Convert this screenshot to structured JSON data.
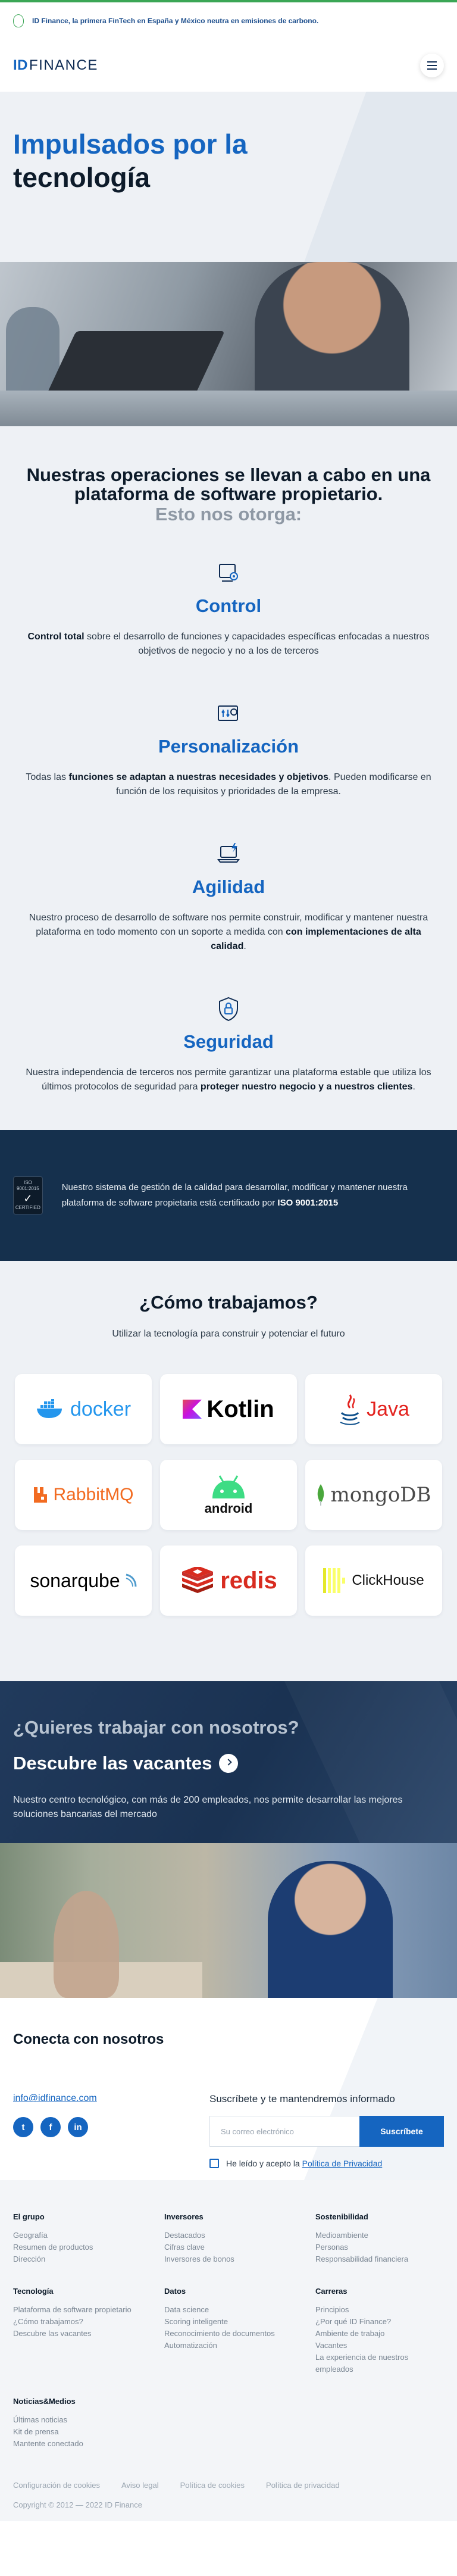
{
  "topbar": {
    "text": "ID Finance, la primera FinTech en España y México neutra en emisiones de carbono."
  },
  "header": {
    "logo_id": "ID",
    "logo_finance": "FINANCE"
  },
  "hero": {
    "title_blue": "Impulsados por la",
    "title_dark": "tecnología"
  },
  "ops": {
    "title": "Nuestras operaciones se llevan a cabo en una plataforma de software propietario.",
    "subtitle": "Esto nos otorga:",
    "features": [
      {
        "icon": "monitor-gear-icon",
        "title": "Control",
        "p1_b": "Control total",
        "p1": " sobre el desarrollo de funciones y capacidades específicas enfocadas a nuestros objetivos de negocio y no a los de terceros",
        "p2": "",
        "p2_b": "",
        "p3": ""
      },
      {
        "icon": "sliders-icon",
        "title": "Personalización",
        "p1": "Todas las ",
        "p1_b": "funciones se adaptan a nuestras necesidades y objetivos",
        "p2": ". Pueden modificarse en función de los requisitos y prioridades de la empresa.",
        "p2_b": "",
        "p3": ""
      },
      {
        "icon": "laptop-lightning-icon",
        "title": "Agilidad",
        "p1": "Nuestro proceso de desarrollo de software nos permite construir, modificar y mantener nuestra plataforma en todo momento con un soporte a medida con ",
        "p1_b": "con implementaciones de alta calidad",
        "p2": ".",
        "p2_b": "",
        "p3": ""
      },
      {
        "icon": "shield-lock-icon",
        "title": "Seguridad",
        "p1": "Nuestra independencia de terceros nos permite garantizar una plataforma estable que utiliza los últimos protocolos de seguridad para ",
        "p1_b": "proteger nuestro negocio y a nuestros clientes",
        "p2": ".",
        "p2_b": "",
        "p3": ""
      }
    ]
  },
  "iso": {
    "badge_top": "ISO 9001:2015",
    "badge_bottom": "CERTIFIED",
    "text": "Nuestro sistema de gestión de la calidad para desarrollar, modificar y mantener nuestra plataforma de software propietaria está certificado por ",
    "text_b": "ISO 9001:2015"
  },
  "how": {
    "title": "¿Cómo trabajamos?",
    "lead": "Utilizar la tecnología para construir y potenciar el futuro",
    "tech": [
      {
        "name": "docker",
        "color": "#2496ed"
      },
      {
        "name": "Kotlin",
        "color": "#000000"
      },
      {
        "name": "Java",
        "color": "#e3231f"
      },
      {
        "name": "RabbitMQ",
        "color": "#f26b21"
      },
      {
        "name": "android",
        "color": "#3ddc84"
      },
      {
        "name": "mongoDB",
        "color": "#4aa73c"
      },
      {
        "name": "sonarqube",
        "color": "#000000"
      },
      {
        "name": "redis",
        "color": "#d82c20"
      },
      {
        "name": "ClickHouse",
        "color": "#111111"
      }
    ]
  },
  "careers": {
    "q": "¿Quieres trabajar con nosotros?",
    "cta": "Descubre las vacantes",
    "desc": "Nuestro centro tecnológico, con más de 200 empleados, nos permite desarrollar las mejores soluciones bancarias del mercado"
  },
  "connect": {
    "title": "Conecta con nosotros",
    "email": "info@idfinance.com",
    "socials": [
      "t",
      "f",
      "in"
    ],
    "newsletter_title": "Suscríbete y te mantendremos informado",
    "placeholder": "Su correo electrónico",
    "button": "Suscríbete",
    "consent": "He leído y acepto la ",
    "consent_link": "Política de Privacidad"
  },
  "footer": {
    "cols": [
      {
        "title": "El grupo",
        "links": [
          "Geografía",
          "Resumen de productos",
          "Dirección"
        ]
      },
      {
        "title": "Inversores",
        "links": [
          "Destacados",
          "Cifras clave",
          "Inversores de bonos"
        ]
      },
      {
        "title": "Sostenibilidad",
        "links": [
          "Medioambiente",
          "Personas",
          "Responsabilidad financiera"
        ]
      },
      {
        "title": "Tecnología",
        "links": [
          "Plataforma de software propietario",
          "¿Cómo trabajamos?",
          "Descubre las vacantes"
        ]
      },
      {
        "title": "Datos",
        "links": [
          "Data science",
          "Scoring inteligente",
          "Reconocimiento de documentos",
          "Automatización"
        ]
      },
      {
        "title": "Carreras",
        "links": [
          "Principios",
          "¿Por qué ID Finance?",
          "Ambiente de trabajo",
          "Vacantes",
          "La experiencia de nuestros empleados"
        ]
      },
      {
        "title": "Noticias&Medios",
        "links": [
          "Últimas noticias",
          "Kit de prensa",
          "Mantente conectado"
        ]
      }
    ],
    "bottom": [
      "Configuración de cookies",
      "Aviso legal",
      "Política de cookies",
      "Política de privacidad"
    ],
    "copyright": "Copyright © 2012 — 2022 ID Finance"
  }
}
